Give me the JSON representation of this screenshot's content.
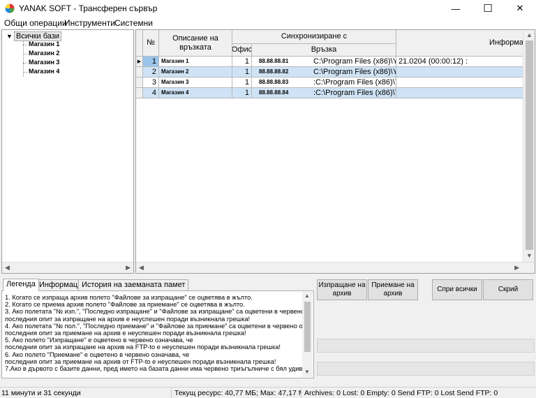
{
  "window": {
    "title": "YANAK SOFT - Трансферен сървър",
    "icon": "app-logo-icon",
    "minimize_glyph": "—",
    "maximize_glyph": "☐",
    "close_glyph": "✕"
  },
  "menu": [
    "Общи операции",
    "Инструменти",
    "Системни"
  ],
  "tree": {
    "expander": "▼",
    "root": "Всички бази",
    "children": [
      "Магазин 1",
      "Магазин 2",
      "Магазин 3",
      "Магазин 4"
    ]
  },
  "grid": {
    "headers": {
      "num": "№",
      "description": "Описание на връзката",
      "sync": "Синхронизиране с",
      "office": "Офис",
      "connection": "Връзка",
      "info": "Информа"
    },
    "current_row_marker": "▶",
    "rows": [
      {
        "num": "1",
        "name": "Магазин 1",
        "office": "1",
        "ip": "88.88.88.81",
        "path": "C:\\Program Files (x86)\\Yanak Sof",
        "info": "21.0204 (00:00:12) :"
      },
      {
        "num": "2",
        "name": "Магазин 2",
        "office": "1",
        "ip": "88.88.88.82",
        "path": "C:\\Program Files (x86)\\Yanak S",
        "info": ""
      },
      {
        "num": "3",
        "name": "Магазин 3",
        "office": "1",
        "ip": "88.88.88.83",
        "path": ":C:\\Program Files (x86)\\Yanak S",
        "info": ""
      },
      {
        "num": "4",
        "name": "Магазин 4",
        "office": "1",
        "ip": "88.88.88.84",
        "path": ":C:\\Program Files (x86)\\Yanak S",
        "info": ""
      }
    ]
  },
  "tabs": [
    "Легенда",
    "Информация",
    "История на заеманата памет"
  ],
  "legend": [
    "1. Когато се изпраща архив полето \"Файлове за изпращане\" се оцветява в жълто.",
    "2. Когато се приема архив полето \"Файлове за приемане\" се оцветява в жълто.",
    "3. Ако полетата \"№ изп.\", \"Последно изпращане\" и \"Файлове за изпращане\" са оцветени в червено о",
    "последния опит за изпращане на архив е неуспешен поради възникнала грешка!",
    "4. Ако полетата \"№ пол.\", \"Последно приемане\" и \"Файлове за приемане\" са оцветени в червено озн",
    "последния опит за приемане на архив е неуспешен поради възникнала грешка!",
    "5. Ако полето \"Изпращане\" е оцветено в червено означава, че",
    "последния опит за изпращане на архив на FTP-to е неуспешен поради възникнала грешка!",
    "6. Ако полето \"Приемане\" е оцветено в червено означава, че",
    "последния опит за приемане на архив от FTP-to е неуспешен поради възникнала грешка!",
    "7.Ако в дървото с базите данни, пред името на базата данни има червено триъгълниче с бял удивите."
  ],
  "actions": {
    "send": "Изпращане на архив",
    "receive": "Приемане на архив",
    "stop_all": "Спри всички",
    "hide": "Скрий"
  },
  "status": {
    "elapsed": "11 минути и 31 секунди",
    "resource": "Текущ ресурс: 40,77 МБ; Max: 47,17 МБ",
    "counters": "Archives: 0 Lost: 0 Empty: 0 Send FTP: 0 Lost Send FTP: 0"
  }
}
